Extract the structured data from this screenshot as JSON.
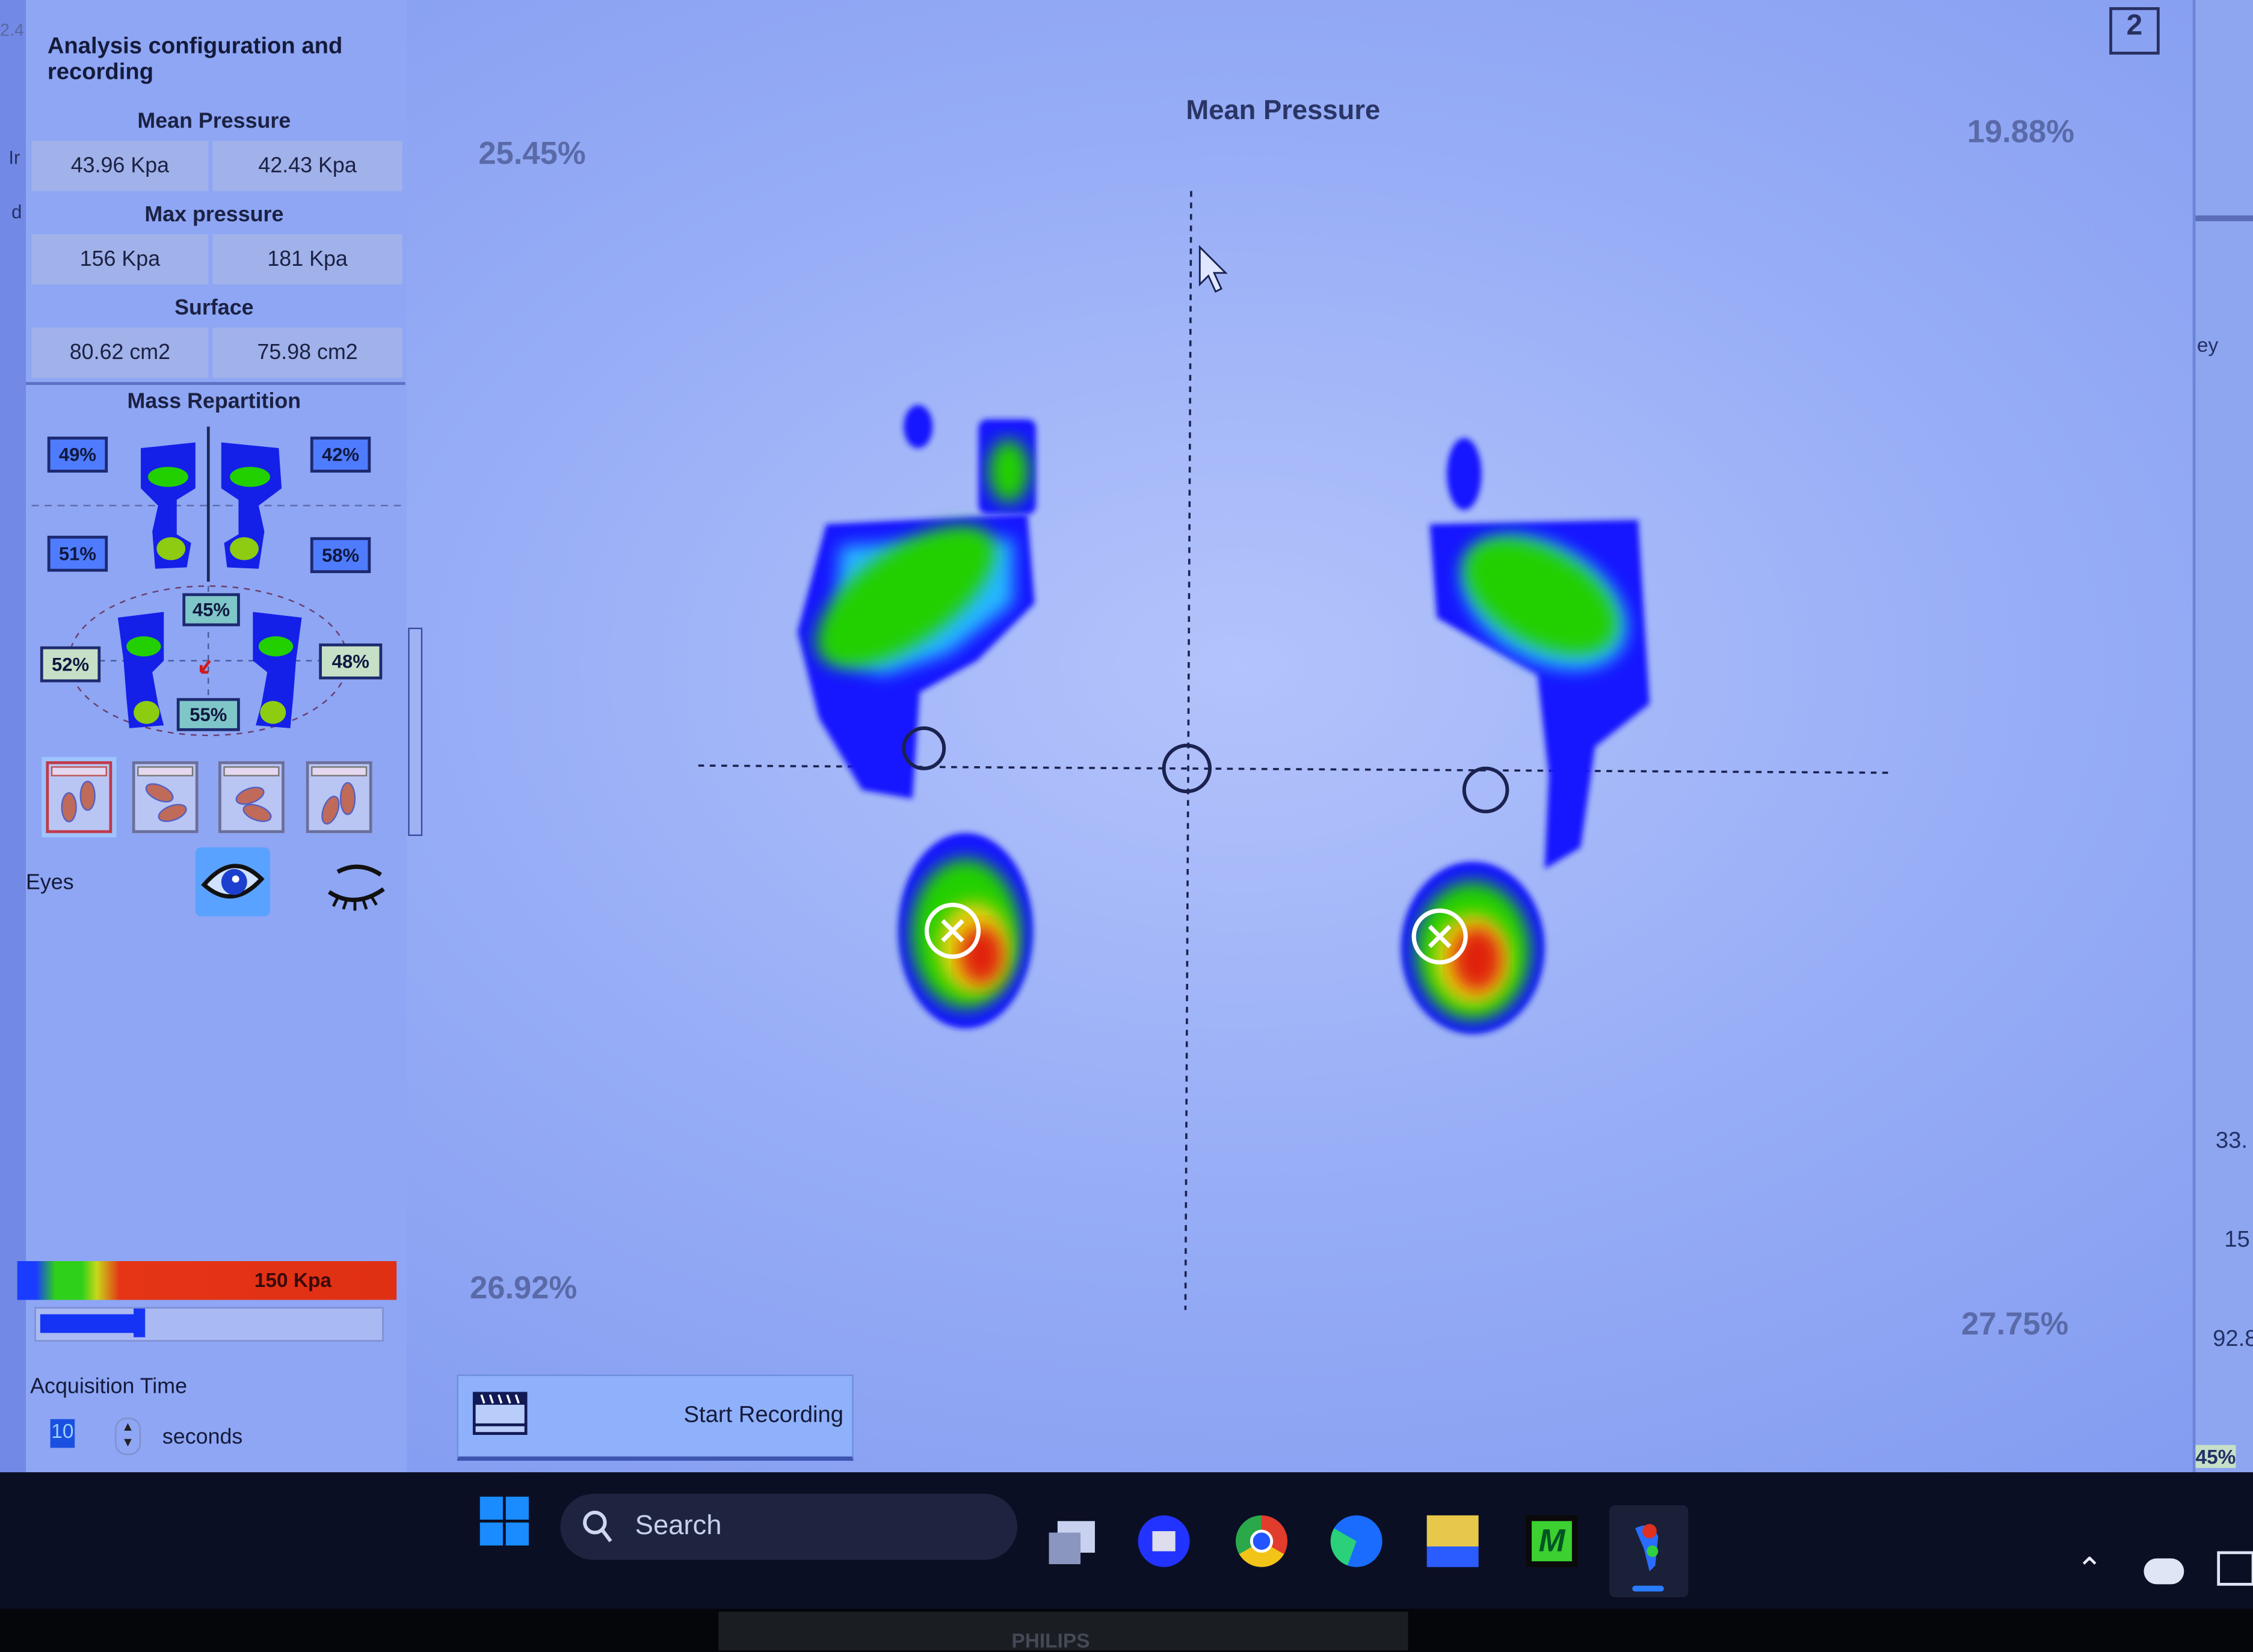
{
  "panel": {
    "title": "Analysis configuration and recording",
    "mean_pressure": {
      "label": "Mean Pressure",
      "left": "43.96 Kpa",
      "right": "42.43 Kpa"
    },
    "max_pressure": {
      "label": "Max pressure",
      "left": "156 Kpa",
      "right": "181 Kpa"
    },
    "surface": {
      "label": "Surface",
      "left": "80.62 cm2",
      "right": "75.98 cm2"
    },
    "mass_repartition": {
      "label": "Mass Repartition",
      "front_left": "49%",
      "front_right": "42%",
      "rear_left": "51%",
      "rear_right": "58%",
      "global_front": "45%",
      "global_rear": "55%",
      "global_left": "52%",
      "global_right": "48%"
    },
    "view_modes": [
      "feet-front-view",
      "feet-rotated-right",
      "feet-rotated-left",
      "feet-diagonal"
    ],
    "eyes": {
      "label": "Eyes",
      "selected": "open"
    },
    "color_scale": {
      "max_label": "150 Kpa",
      "slider_fraction": 0.29
    },
    "acquisition": {
      "label": "Acquisition Time",
      "value": "10",
      "unit": "seconds"
    },
    "record_button": "Start Recording"
  },
  "main": {
    "title": "Mean Pressure",
    "window_number": "2",
    "quadrants": {
      "top_left": "25.45%",
      "top_right": "19.88%",
      "bottom_left": "26.92%",
      "bottom_right": "27.75%"
    }
  },
  "side_fragments": {
    "label": "ey",
    "v1": "33.",
    "v2": "15",
    "v3": "92.8",
    "pct": "45%"
  },
  "bg_fragments": {
    "a": "2.4",
    "b": "Ir",
    "c": "d"
  },
  "taskbar": {
    "search_placeholder": "Search",
    "apps": [
      "task-view",
      "meet",
      "chrome",
      "edge",
      "file-explorer",
      "m-app",
      "foot-analysis-app"
    ]
  },
  "monitor_brand": "PHILIPS",
  "colors": {
    "heat_low": "#1a1aff",
    "heat_mid": "#22d000",
    "heat_high": "#e02010",
    "panel": "#8ea6f4"
  }
}
